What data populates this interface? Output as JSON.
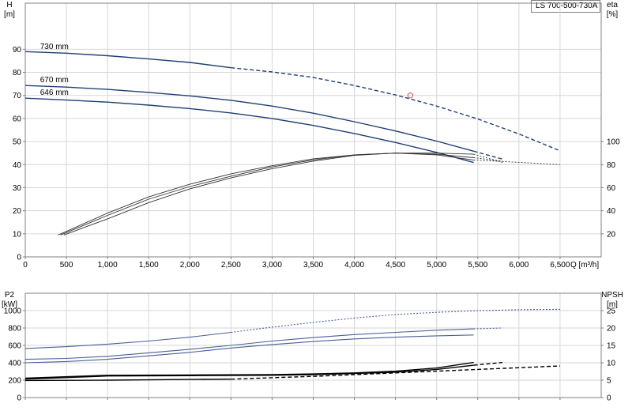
{
  "model_label": "LS 700-500-730A",
  "colors": {
    "head": "#1f3f73",
    "eta": "#333333",
    "p2": "#4a5f96",
    "npsh": "#000000",
    "grid": "#d6d6d6",
    "duty_point": "#e05050"
  },
  "chart_data": [
    {
      "type": "line",
      "title": "",
      "xlabel": "Q [m³/h]",
      "xlim": [
        0,
        7000
      ],
      "x_ticks": [
        0,
        500,
        1000,
        1500,
        2000,
        2500,
        3000,
        3500,
        4000,
        4500,
        5000,
        5500,
        6000,
        6500
      ],
      "x_tick_labels": [
        "0",
        "500",
        "1,000",
        "1,500",
        "2,000",
        "2,500",
        "3,000",
        "3,500",
        "4,000",
        "4,500",
        "5,000",
        "5,500",
        "6,000",
        "6,500"
      ],
      "y_left": {
        "label_top": "H",
        "label_unit": "[m]",
        "lim": [
          0,
          110
        ],
        "ticks": [
          0,
          10,
          20,
          30,
          40,
          50,
          60,
          70,
          80,
          90
        ]
      },
      "y_right": {
        "label_top": "eta",
        "label_unit": "[%]",
        "lim": [
          0,
          220
        ],
        "ticks": [
          20,
          40,
          60,
          80,
          100
        ]
      },
      "grid": true,
      "series": [
        {
          "name": "730 mm",
          "kind": "head",
          "axis": "left",
          "solid": [
            [
              0,
              89
            ],
            [
              500,
              88.3
            ],
            [
              1000,
              87.2
            ],
            [
              1500,
              85.8
            ],
            [
              2000,
              84.3
            ],
            [
              2500,
              82
            ]
          ],
          "dashed": [
            [
              2500,
              82
            ],
            [
              3000,
              80.2
            ],
            [
              3500,
              77.8
            ],
            [
              4000,
              74.3
            ],
            [
              4500,
              70.2
            ],
            [
              5000,
              65.4
            ],
            [
              5500,
              59.8
            ],
            [
              6000,
              53.3
            ],
            [
              6500,
              46
            ]
          ]
        },
        {
          "name": "670 mm",
          "kind": "head",
          "axis": "left",
          "solid": [
            [
              0,
              74.3
            ],
            [
              500,
              73.6
            ],
            [
              1000,
              72.6
            ],
            [
              1500,
              71.3
            ],
            [
              2000,
              69.8
            ],
            [
              2500,
              67.9
            ],
            [
              3000,
              65.4
            ],
            [
              3500,
              62.3
            ],
            [
              4000,
              58.6
            ],
            [
              4500,
              54.6
            ],
            [
              5000,
              50.2
            ],
            [
              5450,
              45.8
            ]
          ],
          "dashed": [
            [
              5450,
              45.8
            ],
            [
              5800,
              42.4
            ]
          ]
        },
        {
          "name": "646 mm",
          "kind": "head",
          "axis": "left",
          "solid": [
            [
              0,
              68.8
            ],
            [
              500,
              68
            ],
            [
              1000,
              67.1
            ],
            [
              1500,
              65.8
            ],
            [
              2000,
              64.3
            ],
            [
              2500,
              62.4
            ],
            [
              3000,
              60
            ],
            [
              3500,
              57
            ],
            [
              4000,
              53.5
            ],
            [
              4500,
              49.6
            ],
            [
              5000,
              45.3
            ],
            [
              5450,
              40.9
            ]
          ],
          "dashed": []
        },
        {
          "name": "",
          "kind": "eta",
          "axis": "right",
          "solid": [
            [
              400,
              19
            ],
            [
              1000,
              38
            ],
            [
              1500,
              52
            ],
            [
              2000,
              63
            ],
            [
              2500,
              72
            ],
            [
              3000,
              79
            ],
            [
              3500,
              85
            ],
            [
              4000,
              88.5
            ],
            [
              4500,
              90
            ],
            [
              5000,
              88.5
            ],
            [
              5450,
              84
            ]
          ],
          "dashed": [
            [
              5450,
              84
            ],
            [
              6000,
              82
            ],
            [
              6500,
              80
            ]
          ]
        },
        {
          "name": "",
          "kind": "eta",
          "axis": "right",
          "solid": [
            [
              430,
              19
            ],
            [
              1000,
              36
            ],
            [
              1500,
              50
            ],
            [
              2000,
              61
            ],
            [
              2500,
              70
            ],
            [
              3000,
              78
            ],
            [
              3500,
              84
            ],
            [
              4000,
              88.5
            ],
            [
              4500,
              90
            ],
            [
              5000,
              89
            ],
            [
              5450,
              86
            ]
          ],
          "dashed": [
            [
              5450,
              86
            ],
            [
              5800,
              83
            ]
          ]
        },
        {
          "name": "",
          "kind": "eta",
          "axis": "right",
          "solid": [
            [
              470,
              19
            ],
            [
              1000,
              33
            ],
            [
              1500,
              47
            ],
            [
              2000,
              59
            ],
            [
              2500,
              68.5
            ],
            [
              3000,
              76.5
            ],
            [
              3500,
              83
            ],
            [
              4000,
              88
            ],
            [
              4500,
              90
            ],
            [
              5000,
              90
            ],
            [
              5450,
              89
            ]
          ],
          "dashed": [
            [
              5450,
              89
            ],
            [
              5800,
              82
            ]
          ]
        }
      ],
      "duty_point": {
        "x": 4680,
        "y": 70
      },
      "curve_labels": [
        {
          "text": "730 mm",
          "x": 180,
          "y": 89.5
        },
        {
          "text": "670 mm",
          "x": 180,
          "y": 75
        },
        {
          "text": "646 mm",
          "x": 180,
          "y": 69.5
        }
      ]
    },
    {
      "type": "line",
      "title": "",
      "xlim": [
        0,
        7000
      ],
      "x_ticks": [
        0,
        500,
        1000,
        1500,
        2000,
        2500,
        3000,
        3500,
        4000,
        4500,
        5000,
        5500,
        6000,
        6500
      ],
      "y_left": {
        "label_top": "P2",
        "label_unit": "[kW]",
        "lim": [
          0,
          1200
        ],
        "ticks": [
          0,
          200,
          400,
          600,
          800,
          1000
        ]
      },
      "y_right": {
        "label_top": "NPSH",
        "label_unit": "[m]",
        "lim": [
          0,
          30
        ],
        "ticks": [
          0,
          5,
          10,
          15,
          20,
          25
        ]
      },
      "grid": true,
      "series": [
        {
          "name": "",
          "kind": "p2",
          "axis": "left",
          "solid": [
            [
              0,
              565
            ],
            [
              500,
              585
            ],
            [
              1000,
              615
            ],
            [
              1500,
              650
            ],
            [
              2000,
              695
            ],
            [
              2500,
              750
            ]
          ],
          "dashed": [
            [
              2500,
              750
            ],
            [
              3000,
              810
            ],
            [
              3500,
              865
            ],
            [
              4000,
              915
            ],
            [
              4500,
              955
            ],
            [
              5000,
              980
            ],
            [
              5500,
              1000
            ],
            [
              6000,
              1010
            ],
            [
              6500,
              1015
            ]
          ]
        },
        {
          "name": "",
          "kind": "p2",
          "axis": "left",
          "solid": [
            [
              0,
              440
            ],
            [
              500,
              450
            ],
            [
              1000,
              475
            ],
            [
              1500,
              515
            ],
            [
              2000,
              555
            ],
            [
              2500,
              600
            ],
            [
              3000,
              650
            ],
            [
              3500,
              690
            ],
            [
              4000,
              725
            ],
            [
              4500,
              750
            ],
            [
              5000,
              775
            ],
            [
              5450,
              790
            ]
          ],
          "dashed": [
            [
              5450,
              790
            ],
            [
              5800,
              800
            ]
          ]
        },
        {
          "name": "",
          "kind": "p2",
          "axis": "left",
          "solid": [
            [
              0,
              400
            ],
            [
              500,
              415
            ],
            [
              1000,
              440
            ],
            [
              1500,
              480
            ],
            [
              2000,
              520
            ],
            [
              2500,
              570
            ],
            [
              3000,
              610
            ],
            [
              3500,
              645
            ],
            [
              4000,
              675
            ],
            [
              4500,
              695
            ],
            [
              5000,
              710
            ],
            [
              5450,
              720
            ]
          ],
          "dashed": []
        },
        {
          "name": "",
          "kind": "npsh",
          "axis": "right",
          "solid": [
            [
              0,
              5.6
            ],
            [
              1000,
              6.4
            ],
            [
              2000,
              6.5
            ],
            [
              3000,
              6.6
            ],
            [
              3500,
              6.8
            ],
            [
              4000,
              7.1
            ],
            [
              4500,
              7.6
            ],
            [
              5000,
              8.5
            ],
            [
              5450,
              10.1
            ]
          ],
          "dashed": []
        },
        {
          "name": "",
          "kind": "npsh",
          "axis": "right",
          "solid": [
            [
              0,
              5.3
            ],
            [
              1000,
              6.2
            ],
            [
              2000,
              6.3
            ],
            [
              3000,
              6.4
            ],
            [
              3500,
              6.6
            ],
            [
              4000,
              6.9
            ],
            [
              4500,
              7.3
            ],
            [
              5000,
              8.1
            ],
            [
              5450,
              9.3
            ]
          ],
          "dashed": [
            [
              5450,
              9.3
            ],
            [
              5800,
              10.1
            ]
          ]
        },
        {
          "name": "",
          "kind": "npsh",
          "axis": "right",
          "solid": [
            [
              0,
              4.9
            ],
            [
              1000,
              5.0
            ],
            [
              2000,
              5.2
            ],
            [
              2500,
              5.3
            ]
          ],
          "dashed": [
            [
              2500,
              5.3
            ],
            [
              3000,
              5.7
            ],
            [
              3500,
              6.1
            ],
            [
              4000,
              6.6
            ],
            [
              4500,
              7.1
            ],
            [
              5000,
              7.6
            ],
            [
              5500,
              8.1
            ],
            [
              6000,
              8.6
            ],
            [
              6500,
              9.1
            ]
          ]
        }
      ]
    }
  ]
}
